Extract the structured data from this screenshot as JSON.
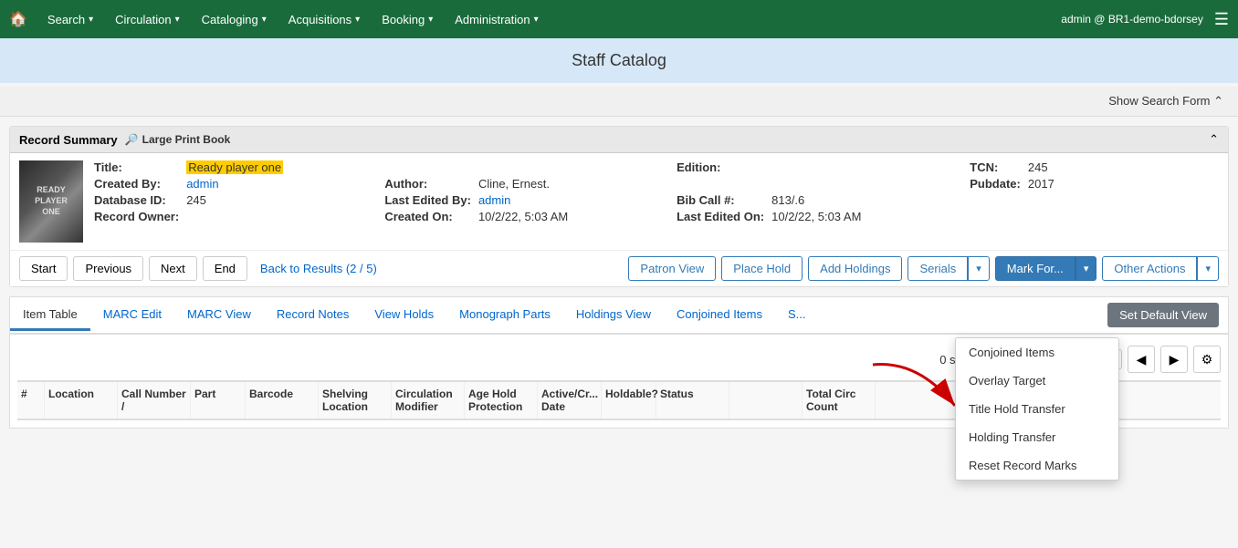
{
  "nav": {
    "home_icon": "🏠",
    "items": [
      {
        "label": "Search",
        "caret": "▾"
      },
      {
        "label": "Circulation",
        "caret": "▾"
      },
      {
        "label": "Cataloging",
        "caret": "▾"
      },
      {
        "label": "Acquisitions",
        "caret": "▾"
      },
      {
        "label": "Booking",
        "caret": "▾"
      },
      {
        "label": "Administration",
        "caret": "▾"
      }
    ],
    "user": "admin @ BR1-demo-bdorsey",
    "menu_icon": "☰"
  },
  "catalog_banner": "Staff Catalog",
  "search_form_btn": "Show Search Form ⌃",
  "record_summary": {
    "title": "Record Summary",
    "type_icon": "🔎",
    "type_label": "Large Print Book",
    "collapse_icon": "⌃",
    "fields": {
      "title_label": "Title:",
      "title_value": "Ready player one",
      "author_label": "Author:",
      "author_value": "Cline, Ernest.",
      "bib_call_label": "Bib Call #:",
      "bib_call_value": "813/.6",
      "edition_label": "Edition:",
      "edition_value": "",
      "pubdate_label": "Pubdate:",
      "pubdate_value": "2017",
      "record_owner_label": "Record Owner:",
      "record_owner_value": "",
      "tcn_label": "TCN:",
      "tcn_value": "245",
      "database_id_label": "Database ID:",
      "database_id_value": "245",
      "created_on_label": "Created On:",
      "created_on_value": "10/2/22, 5:03 AM",
      "created_by_label": "Created By:",
      "created_by_value": "admin",
      "last_edited_by_label": "Last Edited By:",
      "last_edited_by_value": "admin",
      "last_edited_on_label": "Last Edited On:",
      "last_edited_on_value": "10/2/22, 5:03 AM"
    }
  },
  "action_bar": {
    "start_label": "Start",
    "previous_label": "Previous",
    "next_label": "Next",
    "end_label": "End",
    "back_to_results": "Back to Results (2 / 5)",
    "patron_view": "Patron View",
    "place_hold": "Place Hold",
    "add_holdings": "Add Holdings",
    "serials": "Serials",
    "mark_for": "Mark For...",
    "other_actions": "Other Actions",
    "set_default_view": "Set Default View"
  },
  "tabs": [
    {
      "label": "Item Table",
      "active": true
    },
    {
      "label": "MARC Edit",
      "active": false
    },
    {
      "label": "MARC View",
      "active": false
    },
    {
      "label": "Record Notes",
      "active": false
    },
    {
      "label": "View Holds",
      "active": false
    },
    {
      "label": "Monograph Parts",
      "active": false
    },
    {
      "label": "Holdings View",
      "active": false
    },
    {
      "label": "Conjoined Items",
      "active": false
    },
    {
      "label": "S...",
      "active": false
    }
  ],
  "table": {
    "selected_count": "0 selected",
    "columns": [
      "#",
      "Location",
      "Call Number /",
      "Part",
      "Barcode",
      "Shelving Location",
      "Circulation Modifier",
      "Age Hold Protection",
      "Active/Cr... Date",
      "Holdable?",
      "Status",
      "",
      "Total Circ Count"
    ]
  },
  "dropdown": {
    "items": [
      "Conjoined Items",
      "Overlay Target",
      "Title Hold Transfer",
      "Holding Transfer",
      "Reset Record Marks"
    ]
  }
}
